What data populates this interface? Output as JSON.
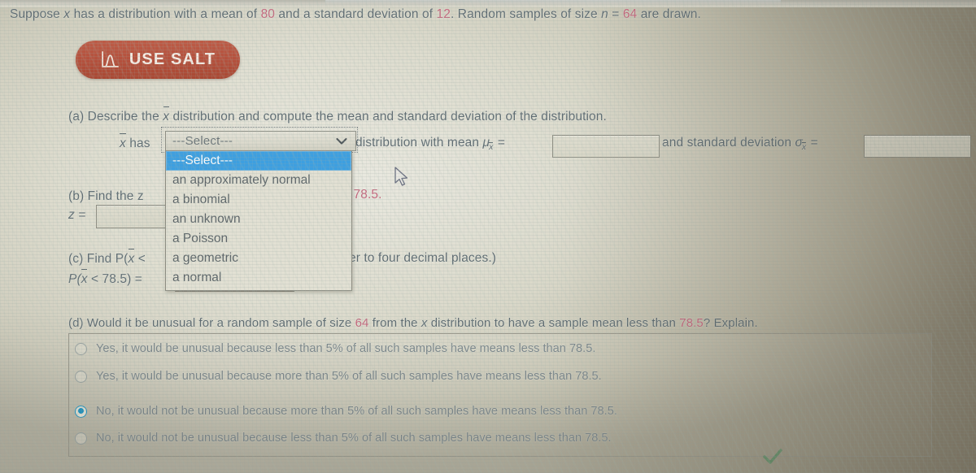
{
  "statement": {
    "prefix": "Suppose ",
    "var": "x",
    "mid1": " has a distribution with a mean of ",
    "mean": "80",
    "mid2": " and a standard deviation of ",
    "sd": "12",
    "mid3": ". Random samples of size ",
    "n_var": "n",
    "eq": " = ",
    "n": "64",
    "suffix": " are drawn."
  },
  "salt_button": {
    "label": "USE SALT",
    "icon": "normal-curve-icon",
    "color": "#b5513d"
  },
  "part_a": {
    "prompt_pre": "(a) Describe the ",
    "prompt_var": "x",
    "prompt_post": " distribution and compute the mean and standard deviation of the distribution.",
    "xhas_var": "x",
    "xhas_text": " has",
    "after_select": "distribution with mean ",
    "mu_symbol": "μ",
    "mu_sub": "x",
    "mu_eq": " = ",
    "and_text": "and standard deviation ",
    "sigma_symbol": "σ",
    "sigma_sub": "x",
    "sigma_eq": " = ",
    "mean_input_value": "",
    "sd_input_value": ""
  },
  "select": {
    "value": "---Select---",
    "icon": "chevron-down-icon",
    "options": [
      "---Select---",
      "an approximately normal",
      "a binomial",
      "an unknown",
      "a Poisson",
      "a geometric",
      "a normal"
    ],
    "highlighted_index": 0,
    "highlight_color": "#3d9fe0"
  },
  "part_b": {
    "prompt": "(b) Find the z",
    "tail": "= 78.5.",
    "z_label": "z = ",
    "z_input_value": ""
  },
  "part_c": {
    "prompt_pre": "(c) Find P(",
    "prompt_var": "x",
    "prompt_post": " <",
    "tail": "er to four decimal places.)",
    "result_pre": "P(",
    "result_var": "x",
    "result_post": " < 78.5) =",
    "p_input_value": ""
  },
  "part_d": {
    "prompt_pre": "(d) Would it be unusual for a random sample of size ",
    "size": "64",
    "prompt_mid": " from the ",
    "prompt_var": "x",
    "prompt_post": " distribution to have a sample mean less than ",
    "threshold": "78.5",
    "prompt_end": "? Explain.",
    "choices": [
      {
        "label": "Yes, it would be unusual because less than 5% of all such samples have means less than 78.5.",
        "selected": false
      },
      {
        "label": "Yes, it would be unusual because more than 5% of all such samples have means less than 78.5.",
        "selected": false
      },
      {
        "label": "No, it would not be unusual because more than 5% of all such samples have means less than 78.5.",
        "selected": true
      },
      {
        "label": "No, it would not be unusual because less than 5% of all such samples have means less than 78.5.",
        "selected": false
      }
    ],
    "status_icon": "green-checkmark-icon"
  },
  "cursor": {
    "icon": "mouse-pointer-icon"
  }
}
